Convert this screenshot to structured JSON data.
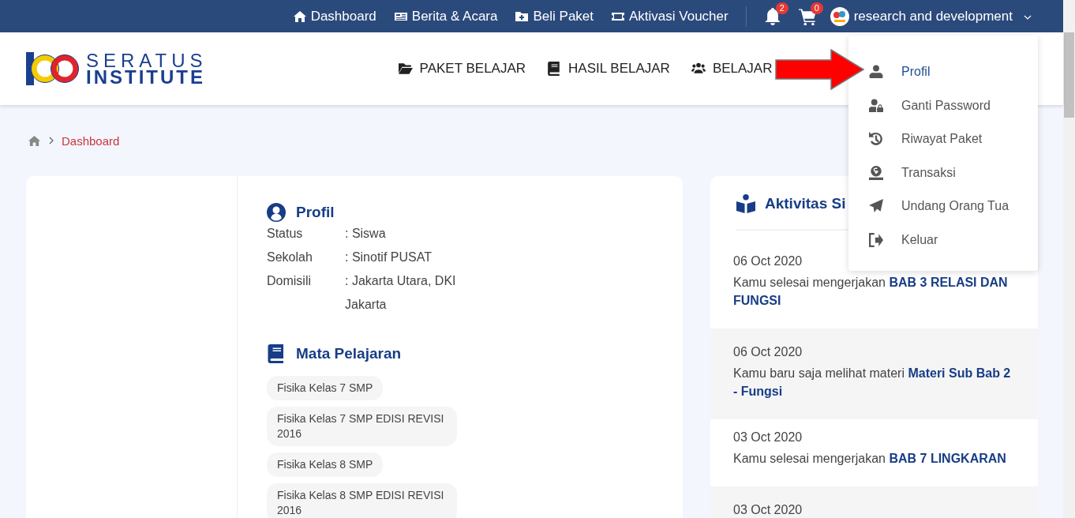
{
  "top_bar": {
    "links": [
      {
        "label": "Dashboard"
      },
      {
        "label": "Berita & Acara"
      },
      {
        "label": "Beli Paket"
      },
      {
        "label": "Aktivasi Voucher"
      }
    ],
    "notifications": {
      "count": "2"
    },
    "cart": {
      "count": "0"
    },
    "user": {
      "name": "research and development"
    }
  },
  "header": {
    "logo": {
      "line_1": "SERATUS",
      "line_2": "INSTITUTE"
    },
    "nav": [
      {
        "label": "PAKET BELAJAR"
      },
      {
        "label": "HASIL BELAJAR"
      },
      {
        "label": "BELAJAR"
      }
    ]
  },
  "user_menu": {
    "items": [
      {
        "label": "Profil",
        "selected": true
      },
      {
        "label": "Ganti Password",
        "selected": false
      },
      {
        "label": "Riwayat Paket",
        "selected": false
      },
      {
        "label": "Transaksi",
        "selected": false
      },
      {
        "label": "Undang Orang Tua",
        "selected": false
      },
      {
        "label": "Keluar",
        "selected": false
      }
    ]
  },
  "breadcrumb": {
    "current": "Dashboard"
  },
  "profile": {
    "title": "Profil",
    "fields": [
      {
        "label": "Status",
        "value": ": Siswa"
      },
      {
        "label": "Sekolah",
        "value": ": Sinotif PUSAT"
      },
      {
        "label": "Domisili",
        "value": ": Jakarta Utara, DKI Jakarta"
      }
    ]
  },
  "subjects": {
    "title": "Mata Pelajaran",
    "items": [
      "Fisika Kelas 7 SMP",
      "Fisika Kelas 7 SMP EDISI REVISI 2016",
      "Fisika Kelas 8 SMP",
      "Fisika Kelas 8 SMP EDISI REVISI 2016"
    ]
  },
  "activity": {
    "title": "Aktivitas Si",
    "items": [
      {
        "date": "06 Oct 2020",
        "text": "Kamu selesai mengerjakan **BAB 3 RELASI DAN FUNGSI**"
      },
      {
        "date": "06 Oct 2020",
        "text": "Kamu baru saja melihat materi **Materi Sub Bab 2 - Fungsi**"
      },
      {
        "date": "03 Oct 2020",
        "text": "Kamu selesai mengerjakan **BAB 7 LINGKARAN**"
      },
      {
        "date": "03 Oct 2020"
      }
    ]
  }
}
